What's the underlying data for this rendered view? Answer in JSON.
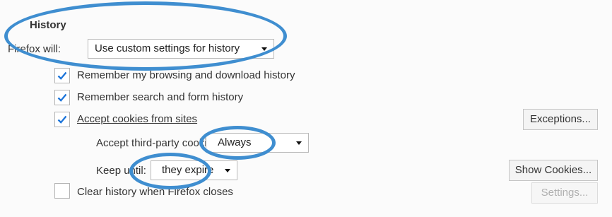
{
  "section": {
    "title": "History"
  },
  "firefox_will": {
    "label": "Firefox will:",
    "value": "Use custom settings for history"
  },
  "checkboxes": [
    {
      "label": "Remember my browsing and download history",
      "checked": true
    },
    {
      "label": "Remember search and form history",
      "checked": true
    },
    {
      "label": "Accept cookies from sites",
      "checked": true
    },
    {
      "label": "Clear history when Firefox closes",
      "checked": false
    }
  ],
  "third_party": {
    "label": "Accept third-party cookies:",
    "value": "Always"
  },
  "keep_until": {
    "label": "Keep until:",
    "value": "they expire"
  },
  "buttons": {
    "exceptions": "Exceptions...",
    "show_cookies": "Show Cookies...",
    "settings": "Settings..."
  },
  "colors": {
    "highlight": "#3f8ed0",
    "checkmark": "#1a73d9"
  }
}
